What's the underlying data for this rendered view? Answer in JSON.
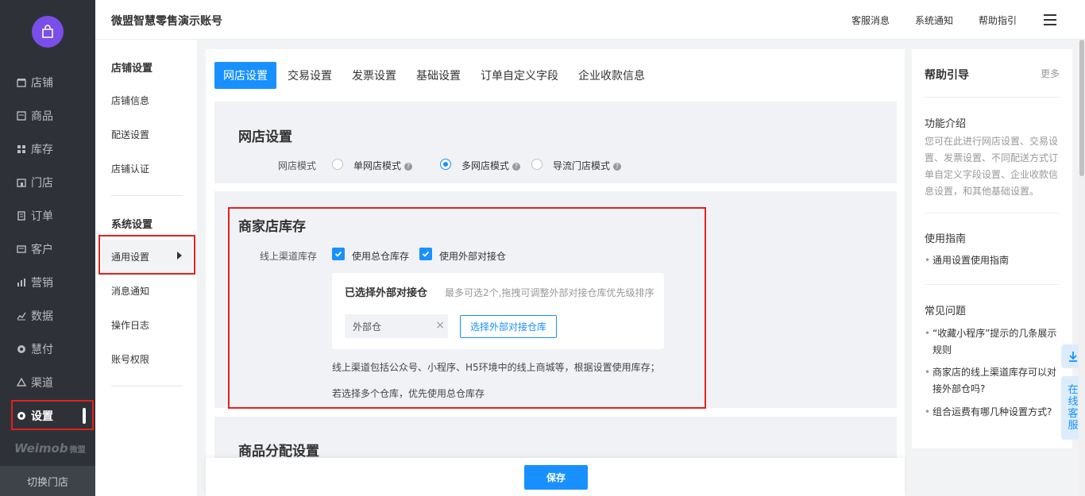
{
  "header": {
    "account": "微盟智慧零售演示账号",
    "links": [
      "客服消息",
      "系统通知",
      "帮助指引"
    ]
  },
  "sidebar": {
    "items": [
      {
        "label": "店铺",
        "icon": "store-icon"
      },
      {
        "label": "商品",
        "icon": "product-icon"
      },
      {
        "label": "库存",
        "icon": "inventory-icon"
      },
      {
        "label": "门店",
        "icon": "shop-icon"
      },
      {
        "label": "订单",
        "icon": "order-icon"
      },
      {
        "label": "客户",
        "icon": "customer-icon"
      },
      {
        "label": "营销",
        "icon": "marketing-icon"
      },
      {
        "label": "数据",
        "icon": "data-icon"
      },
      {
        "label": "慧付",
        "icon": "pay-icon"
      },
      {
        "label": "渠道",
        "icon": "channel-icon"
      },
      {
        "label": "设置",
        "icon": "settings-icon"
      }
    ],
    "brand": "Weimob",
    "brand_cn": "微盟",
    "switch_store": "切换门店"
  },
  "submenu": {
    "group1": "店铺设置",
    "group1_items": [
      "店铺信息",
      "配送设置",
      "店铺认证"
    ],
    "group2": "系统设置",
    "group2_items": [
      "通用设置",
      "消息通知",
      "操作日志",
      "账号权限"
    ]
  },
  "tabs": [
    "网店设置",
    "交易设置",
    "发票设置",
    "基础设置",
    "订单自定义字段",
    "企业收款信息"
  ],
  "shop_settings": {
    "title": "网店设置",
    "mode_label": "网店模式",
    "options": [
      "单网店模式",
      "多网店模式",
      "导流门店模式"
    ],
    "selected": "多网店模式"
  },
  "inventory": {
    "title": "商家店库存",
    "channel_label": "线上渠道库存",
    "check1": "使用总仓库存",
    "check2": "使用外部对接仓",
    "card_title": "已选择外部对接仓",
    "card_hint": "最多可选2个,拖拽可调整外部对接仓库优先级排序",
    "tag": "外部仓",
    "select_button": "选择外部对接仓库",
    "note1": "线上渠道包括公众号、小程序、H5环境中的线上商城等，根据设置使用库存；",
    "note2": "若选择多个仓库，优先使用总仓库存"
  },
  "distribution": {
    "title": "商品分配设置"
  },
  "save": "保存",
  "help": {
    "title": "帮助引导",
    "more": "更多",
    "intro_title": "功能介绍",
    "intro_text": "您可在此进行网店设置、交易设置、发票设置、不同配送方式订单自定义字段设置、企业收款信息设置，和其他基础设置。",
    "guide_title": "使用指南",
    "guide_link": "通用设置使用指南",
    "faq_title": "常见问题",
    "faq": [
      "“收藏小程序”提示的几条展示规则",
      "商家店的线上渠道库存可以对接外部仓吗?",
      "组合运费有哪几种设置方式?"
    ]
  },
  "float": {
    "service": "在线客服"
  },
  "colors": {
    "primary": "#1890ff",
    "sidebar_bg": "#2e3238",
    "highlight": "#e3211d"
  }
}
